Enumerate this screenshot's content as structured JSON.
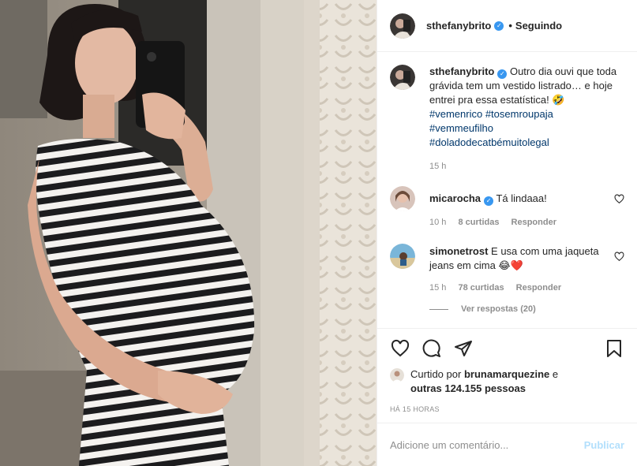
{
  "header": {
    "username": "sthefanybrito",
    "follow_separator": "•",
    "follow_status": "Seguindo"
  },
  "caption": {
    "username": "sthefanybrito",
    "text": "Outro dia ouvi que toda grávida tem um vestido listrado… e hoje entrei pra essa estatística! 🤣",
    "hashtags": [
      "#vemenrico",
      "#tosemroupaja",
      "#vemmeufilho",
      "#doladodecatbémuitolegal"
    ],
    "time": "15 h"
  },
  "comments": [
    {
      "username": "micarocha",
      "verified": true,
      "text": "Tá lindaaa!",
      "time": "10 h",
      "likes": "8 curtidas",
      "reply": "Responder"
    },
    {
      "username": "simonetrost",
      "verified": false,
      "text": "E usa com uma jaqueta jeans em cima 😂❤️",
      "time": "15 h",
      "likes": "78 curtidas",
      "reply": "Responder",
      "view_replies": "Ver respostas (20)"
    }
  ],
  "likes": {
    "prefix": "Curtido por",
    "user": "brunamarquezine",
    "and": "e",
    "others": "outras 124.155 pessoas"
  },
  "timestamp": "HÁ 15 HORAS",
  "add_comment": {
    "placeholder": "Adicione um comentário...",
    "publish": "Publicar"
  },
  "icons": [
    "heart-icon",
    "comment-icon",
    "share-icon",
    "bookmark-icon",
    "verified-icon"
  ],
  "colors": {
    "link": "#00376b",
    "verified": "#3897f0",
    "muted": "#8e8e8e",
    "publish": "#b2dffc",
    "heart_red": "#ed4956"
  }
}
